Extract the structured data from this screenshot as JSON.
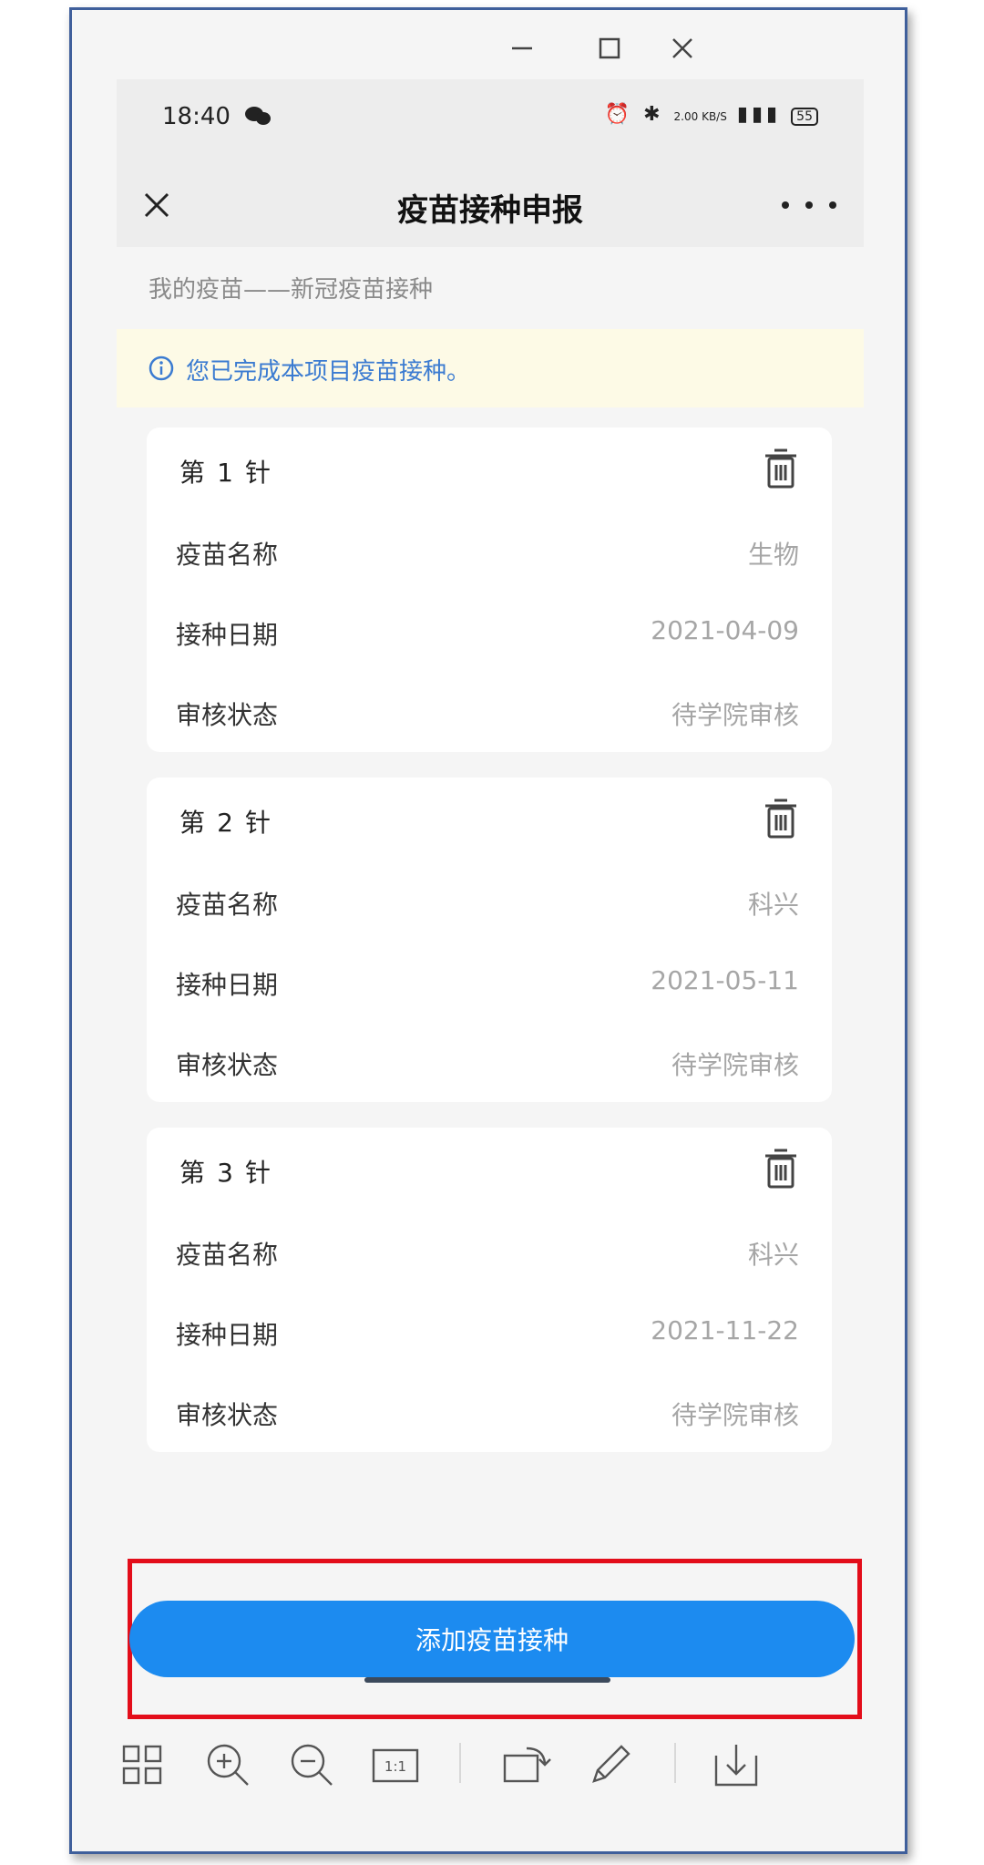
{
  "window": {
    "minimize_icon": "minimize-icon",
    "maximize_icon": "maximize-icon",
    "close_icon": "close-icon"
  },
  "status_bar": {
    "time": "18:40",
    "speed": "2.00 KB/S",
    "battery": "55"
  },
  "nav": {
    "title": "疫苗接种申报"
  },
  "breadcrumb": "我的疫苗——新冠疫苗接种",
  "notice": "您已完成本项目疫苗接种。",
  "doses": [
    {
      "num": "1",
      "vaccine_label": "疫苗名称",
      "vaccine": "生物",
      "date_label": "接种日期",
      "date": "2021-04-09",
      "status_label": "审核状态",
      "status": "待学院审核"
    },
    {
      "num": "2",
      "vaccine_label": "疫苗名称",
      "vaccine": "科兴",
      "date_label": "接种日期",
      "date": "2021-05-11",
      "status_label": "审核状态",
      "status": "待学院审核"
    },
    {
      "num": "3",
      "vaccine_label": "疫苗名称",
      "vaccine": "科兴",
      "date_label": "接种日期",
      "date": "2021-11-22",
      "status_label": "审核状态",
      "status": "待学院审核"
    }
  ],
  "dose_prefix": "第",
  "dose_suffix": "针",
  "add_button": "添加疫苗接种",
  "toolbar": {
    "ratio_label": "1:1"
  },
  "colors": {
    "accent": "#1c8bf0",
    "highlight_border": "#e30d1a",
    "notice_bg": "#fdfae6",
    "notice_text": "#3b7bd1"
  }
}
